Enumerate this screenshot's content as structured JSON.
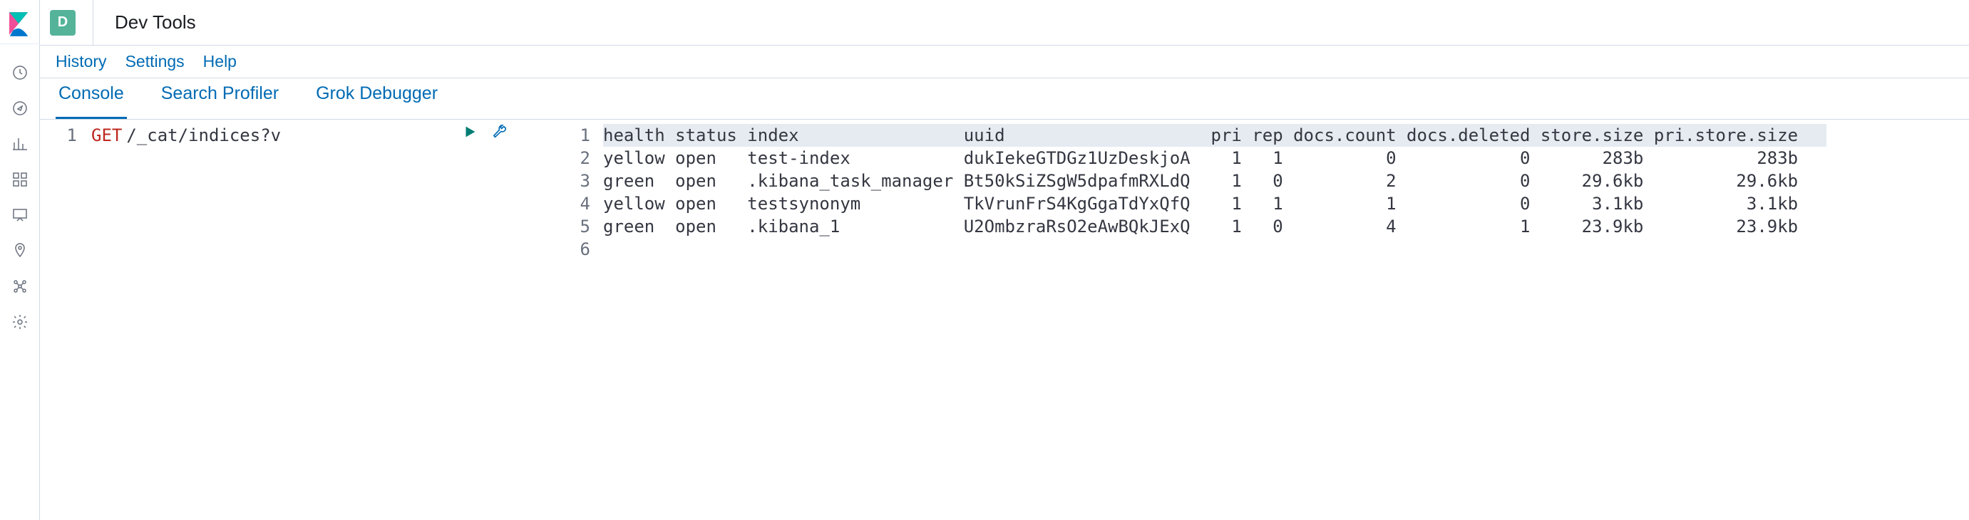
{
  "app_badge_letter": "D",
  "breadcrumb": "Dev Tools",
  "sub_nav": {
    "history": "History",
    "settings": "Settings",
    "help": "Help"
  },
  "tabs": {
    "console": "Console",
    "profiler": "Search Profiler",
    "grok": "Grok Debugger"
  },
  "editor": {
    "gutter": [
      "1"
    ],
    "method": "GET",
    "path": "/_cat/indices?v"
  },
  "output": {
    "gutter": [
      "1",
      "2",
      "3",
      "4",
      "5",
      "6"
    ],
    "columns": [
      "health",
      "status",
      "index",
      "uuid",
      "pri",
      "rep",
      "docs.count",
      "docs.deleted",
      "store.size",
      "pri.store.size"
    ],
    "rows": [
      {
        "health": "yellow",
        "status": "open",
        "index": "test-index",
        "uuid": "dukIekeGTDGz1UzDeskjoA",
        "pri": "1",
        "rep": "1",
        "docs_count": "0",
        "docs_deleted": "0",
        "store_size": "283b",
        "pri_store_size": "283b"
      },
      {
        "health": "green",
        "status": "open",
        "index": ".kibana_task_manager",
        "uuid": "Bt50kSiZSgW5dpafmRXLdQ",
        "pri": "1",
        "rep": "0",
        "docs_count": "2",
        "docs_deleted": "0",
        "store_size": "29.6kb",
        "pri_store_size": "29.6kb"
      },
      {
        "health": "yellow",
        "status": "open",
        "index": "testsynonym",
        "uuid": "TkVrunFrS4KgGgaTdYxQfQ",
        "pri": "1",
        "rep": "1",
        "docs_count": "1",
        "docs_deleted": "0",
        "store_size": "3.1kb",
        "pri_store_size": "3.1kb"
      },
      {
        "health": "green",
        "status": "open",
        "index": ".kibana_1",
        "uuid": "U2OmbzraRsO2eAwBQkJExQ",
        "pri": "1",
        "rep": "0",
        "docs_count": "4",
        "docs_deleted": "1",
        "store_size": "23.9kb",
        "pri_store_size": "23.9kb"
      }
    ]
  }
}
